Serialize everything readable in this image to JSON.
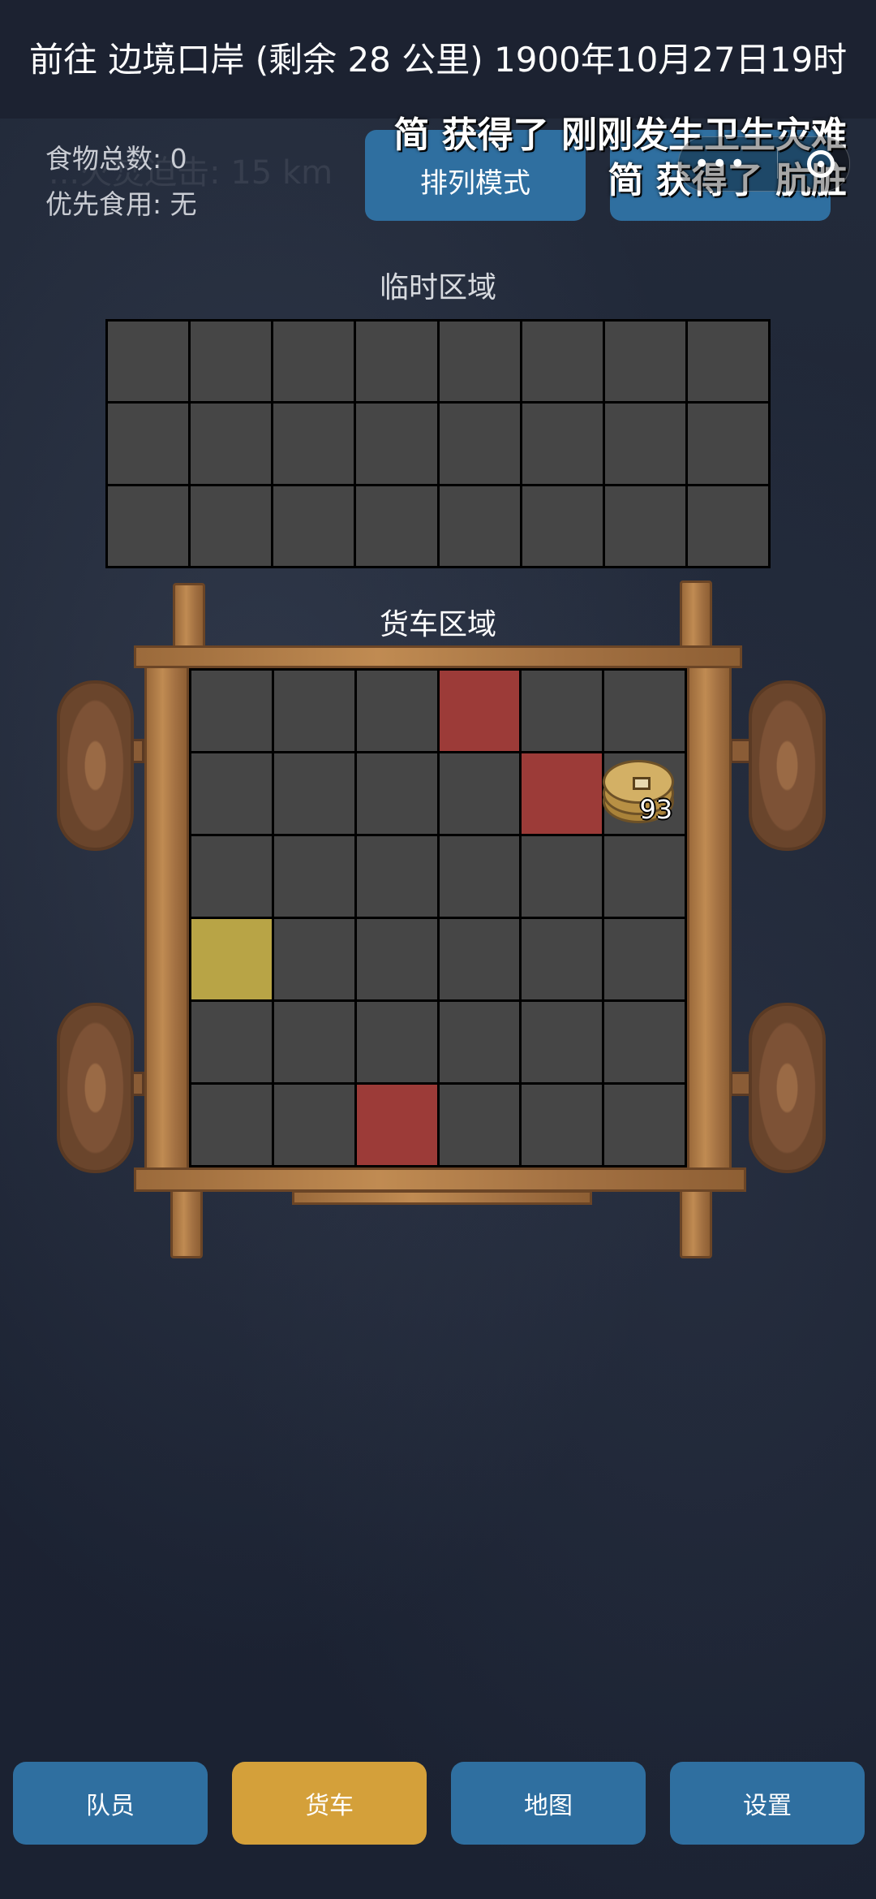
{
  "header": {
    "title": "前往 边境口岸 (剩余 28 公里) 1900年10月27日19时"
  },
  "ghost_text": "...火焚迫击: 15 km",
  "food": {
    "total": "食物总数: 0",
    "priority": "优先食用: 无"
  },
  "buttons": {
    "arrange": "排列模式"
  },
  "notifications": [
    "简 获得了 刚刚发生卫生灾难",
    "简 获得了 肮脏"
  ],
  "capsule": {
    "more_icon": "more-dots-icon",
    "close_icon": "target-ring-icon"
  },
  "temp_area": {
    "label": "临时区域",
    "rows": 3,
    "cols": 8
  },
  "cart_area": {
    "label": "货车区域",
    "rows": 6,
    "cols": 6,
    "red_cells": [
      [
        0,
        3
      ],
      [
        1,
        4
      ],
      [
        5,
        2
      ]
    ],
    "yellow_cells": [
      [
        3,
        0
      ]
    ],
    "coin_item": {
      "icon": "coin-icon",
      "count": "93",
      "row": 1,
      "col": 5
    }
  },
  "colors": {
    "cell": "#464646",
    "red": "#9c3b38",
    "yellow": "#b8a446",
    "nav_blue": "#2f6fa0",
    "nav_active": "#d4a03a"
  },
  "nav": [
    {
      "label": "队员",
      "active": false
    },
    {
      "label": "货车",
      "active": true
    },
    {
      "label": "地图",
      "active": false
    },
    {
      "label": "设置",
      "active": false
    }
  ]
}
